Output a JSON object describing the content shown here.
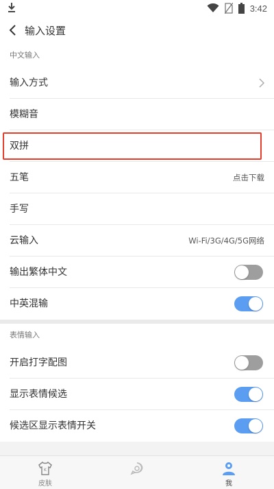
{
  "status_bar": {
    "time": "3:42",
    "icons": [
      "download-icon",
      "wifi-icon",
      "no-sim-icon",
      "battery-icon"
    ]
  },
  "header": {
    "title": "输入设置"
  },
  "sections": {
    "chinese": {
      "title": "中文输入",
      "rows": {
        "input_method": {
          "label": "输入方式"
        },
        "fuzzy": {
          "label": "模糊音"
        },
        "shuangpin": {
          "label": "双拼"
        },
        "wubi": {
          "label": "五笔",
          "value": "点击下载"
        },
        "handwriting": {
          "label": "手写"
        },
        "cloud": {
          "label": "云输入",
          "value": "Wi-Fi/3G/4G/5G网络"
        },
        "traditional": {
          "label": "输出繁体中文",
          "toggle": false
        },
        "mixed": {
          "label": "中英混输",
          "toggle": true
        }
      }
    },
    "emoji": {
      "title": "表情输入",
      "rows": {
        "typing_pic": {
          "label": "开启打字配图",
          "toggle": false
        },
        "emoji_candidates": {
          "label": "显示表情候选",
          "toggle": true
        },
        "candidate_switch": {
          "label": "候选区显示表情开关",
          "toggle": true
        }
      }
    }
  },
  "tabs": {
    "skin": {
      "label": "皮肤"
    },
    "me": {
      "label": "我"
    }
  },
  "colors": {
    "toggle_on": "#5b9df1",
    "toggle_off": "#9e9e9e",
    "highlight": "#e53d2c"
  }
}
